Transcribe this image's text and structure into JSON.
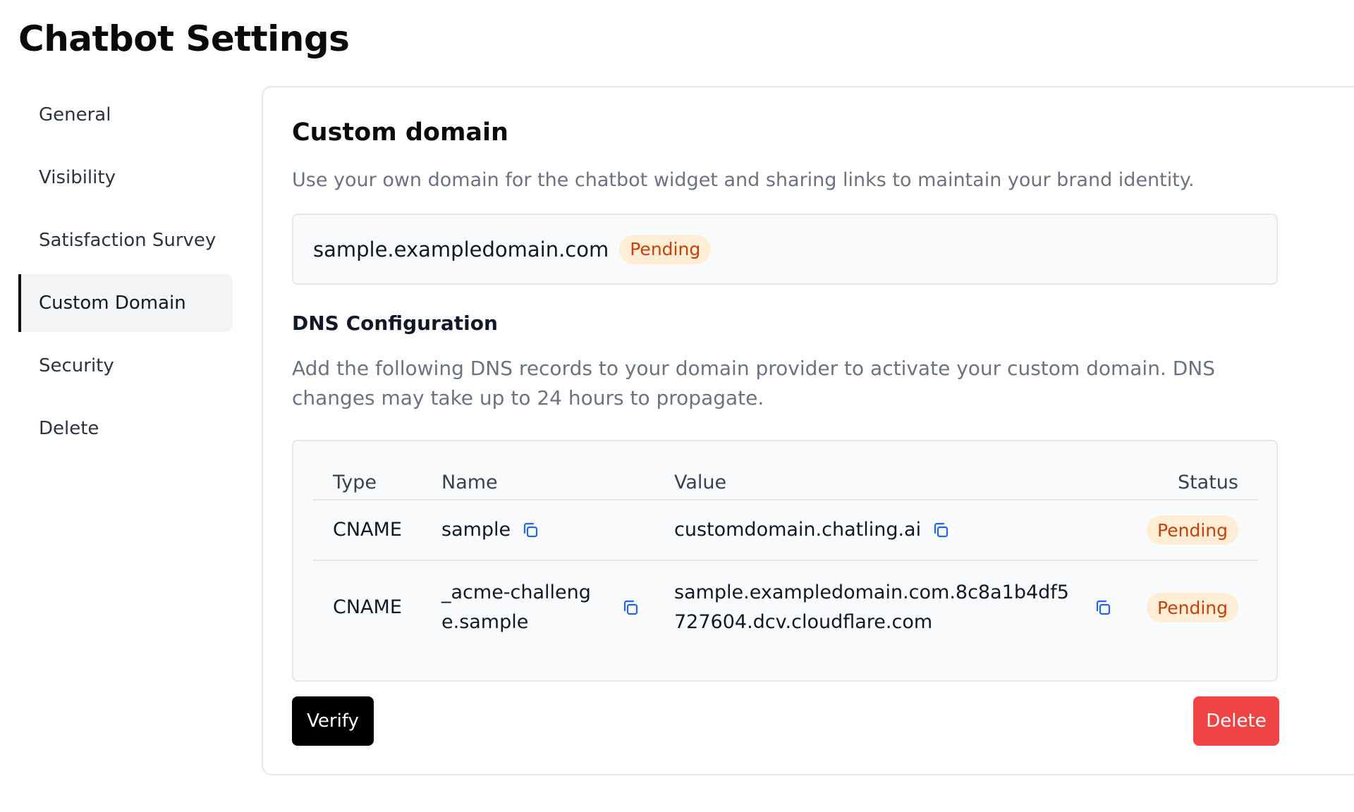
{
  "page": {
    "title": "Chatbot Settings"
  },
  "sidebar": {
    "items": [
      {
        "label": "General",
        "active": false
      },
      {
        "label": "Visibility",
        "active": false
      },
      {
        "label": "Satisfaction Survey",
        "active": false
      },
      {
        "label": "Custom Domain",
        "active": true
      },
      {
        "label": "Security",
        "active": false
      },
      {
        "label": "Delete",
        "active": false
      }
    ]
  },
  "custom_domain": {
    "title": "Custom domain",
    "description": "Use your own domain for the chatbot widget and sharing links to maintain your brand identity.",
    "domain": "sample.exampledomain.com",
    "status": "Pending"
  },
  "dns": {
    "title": "DNS Configuration",
    "description": "Add the following DNS records to your domain provider to activate your custom domain. DNS changes may take up to 24 hours to propagate.",
    "columns": {
      "type": "Type",
      "name": "Name",
      "value": "Value",
      "status": "Status"
    },
    "records": [
      {
        "type": "CNAME",
        "name": "sample",
        "value": "customdomain.chatling.ai",
        "status": "Pending"
      },
      {
        "type": "CNAME",
        "name": "_acme-challenge.sample",
        "value": "sample.exampledomain.com.8c8a1b4df5727604.dcv.cloudflare.com",
        "status": "Pending"
      }
    ]
  },
  "actions": {
    "verify_label": "Verify",
    "delete_label": "Delete"
  },
  "colors": {
    "accent_black": "#000000",
    "danger": "#ef4444",
    "pending_bg": "#ffedd5",
    "pending_text": "#c2410c",
    "copy_icon": "#2563eb"
  },
  "icons": {
    "copy": "copy-icon"
  }
}
